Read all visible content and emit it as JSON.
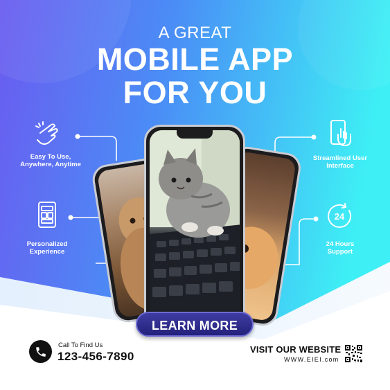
{
  "headline": {
    "line1": "A GREAT",
    "line2": "MOBILE APP",
    "line3": "FOR YOU"
  },
  "features": {
    "left_top": {
      "icon": "gesture-hand-icon",
      "line1": "Easy To Use,",
      "line2": "Anywhere, Anytime"
    },
    "left_bottom": {
      "icon": "phone-layout-icon",
      "line1": "Personalized",
      "line2": "Experience"
    },
    "right_top": {
      "icon": "phone-touch-icon",
      "line1": "Streamlined User",
      "line2": "Interface"
    },
    "right_bottom": {
      "icon": "clock-24-icon",
      "badge": "24",
      "line1": "24 Hours",
      "line2": "Support"
    }
  },
  "cta": {
    "label": "LEARN MORE"
  },
  "contact": {
    "label": "Call To Find Us",
    "phone": "123-456-7890",
    "icon": "phone-icon"
  },
  "website": {
    "heading": "VISIT OUR WEBSITE",
    "url": "WWW.EIEI.com",
    "icon": "qr-code-icon"
  },
  "colors": {
    "gradient_start": "#6a5cf0",
    "gradient_end": "#3ee8f3",
    "cta": "#2c2a8a",
    "text_dark": "#111111"
  }
}
